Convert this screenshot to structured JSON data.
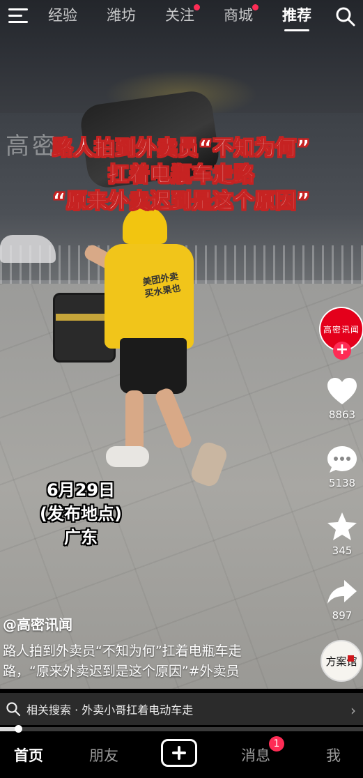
{
  "topnav": {
    "tabs": [
      {
        "label": "经验",
        "has_dot": false
      },
      {
        "label": "潍坊",
        "has_dot": false
      },
      {
        "label": "关注",
        "has_dot": true
      },
      {
        "label": "商城",
        "has_dot": true
      },
      {
        "label": "推荐",
        "has_dot": false,
        "active": true
      }
    ],
    "menu_icon": "hamburger-menu-icon",
    "search_icon": "search-icon"
  },
  "video": {
    "watermark_logo": "高密",
    "caption_lines": [
      "路人拍到外卖员“不知为何”",
      "扛着电瓶车走路",
      "“原来外卖迟到是这个原因”"
    ],
    "shirt_text": "美团外卖 买水果也",
    "date_overlay": [
      "6月29日",
      "(发布地点)",
      "广东"
    ]
  },
  "rail": {
    "avatar_text": "高密讯闻",
    "like_count": "8863",
    "comment_count": "5138",
    "favorite_count": "345",
    "share_count": "897",
    "music_disc_text": "方案馆"
  },
  "post": {
    "author": "@高密讯闻",
    "description": "路人拍到外卖员“不知为何”扛着电瓶车走路，“原来外卖迟到是这个原因”#外卖员"
  },
  "related_search": {
    "label": "相关搜索 · 外卖小哥扛着电动车走",
    "chevron": "›"
  },
  "playback": {
    "progress_fraction": 0.05
  },
  "bottom": {
    "tabs": [
      {
        "label": "首页",
        "active": true
      },
      {
        "label": "朋友"
      },
      {
        "label": "消息",
        "badge": "1"
      },
      {
        "label": "我"
      }
    ],
    "create_icon": "plus-icon"
  },
  "colors": {
    "accent_red": "#fe2c55",
    "caption_red": "#c62322",
    "helmet_yellow": "#f2c510"
  }
}
